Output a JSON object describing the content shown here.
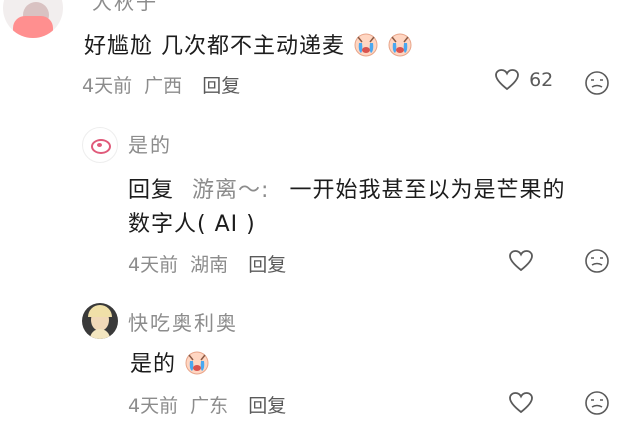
{
  "comment1": {
    "username": "大秋子",
    "text": "好尴尬 几次都不主动递麦",
    "emoji": [
      "cry-emoji",
      "cry-emoji"
    ],
    "time": "4天前",
    "location": "广西",
    "reply_label": "回复",
    "like_count": "62"
  },
  "reply1": {
    "username": "是的",
    "reply_prefix": "回复",
    "reply_to": "游离～:",
    "text_line1": "一开始我甚至以为是芒果的",
    "text_line2": "数字人( AI )",
    "time": "4天前",
    "location": "湖南",
    "reply_label": "回复"
  },
  "reply2": {
    "username": "快吃奥利奥",
    "text": "是的",
    "emoji": [
      "cry-emoji"
    ],
    "time": "4天前",
    "location": "广东",
    "reply_label": "回复"
  },
  "colors": {
    "text": "#1c1c1c",
    "muted": "#8c8c8c",
    "emoji_face": "#ffd6c2",
    "tears": "#4aa8f0"
  }
}
